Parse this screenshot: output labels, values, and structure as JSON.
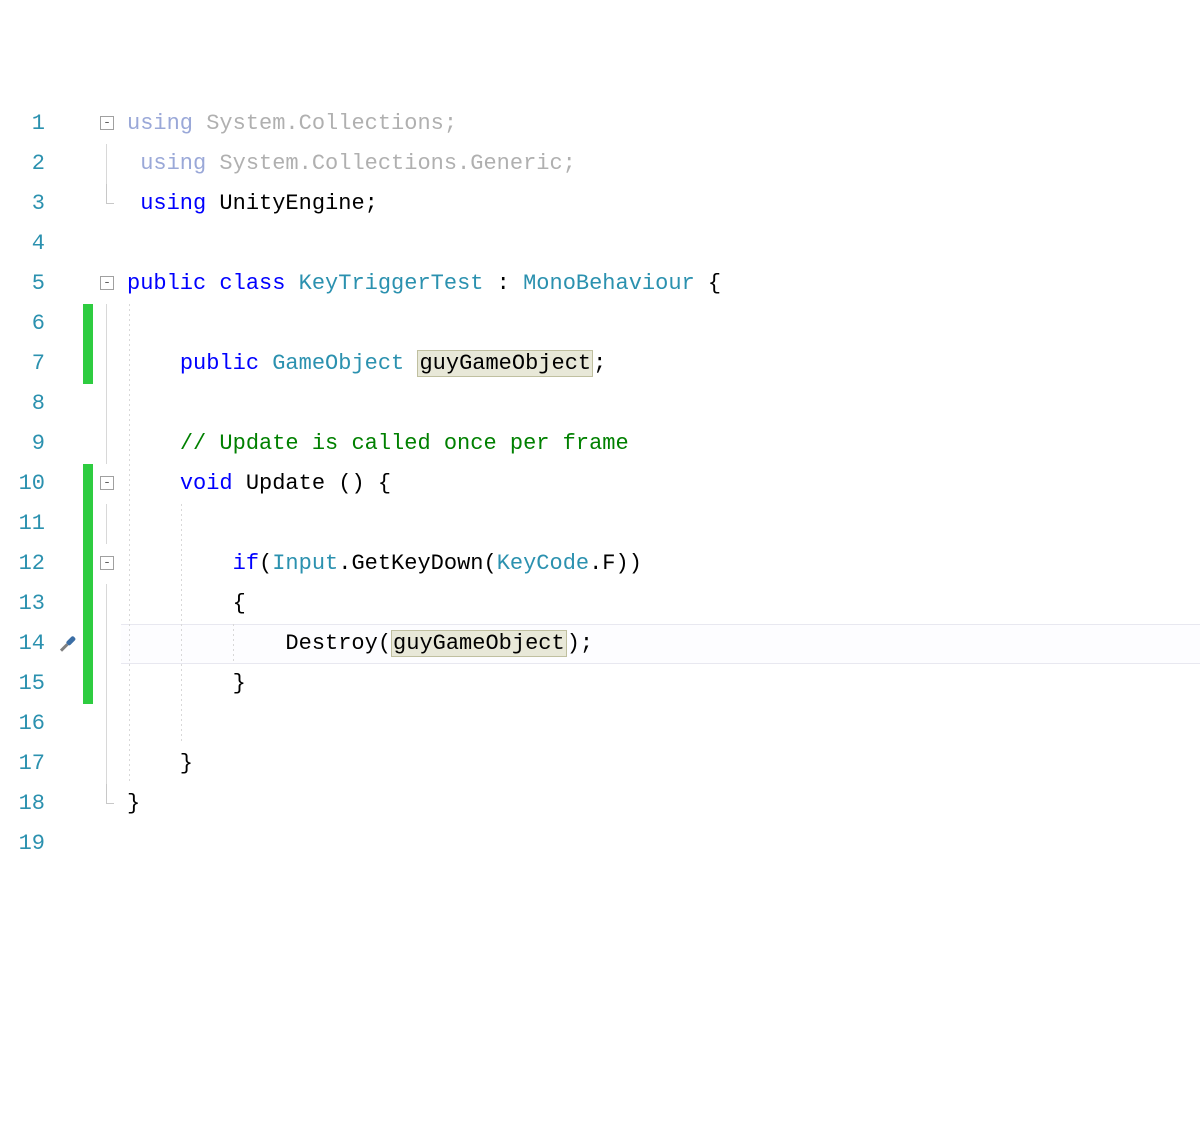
{
  "code": {
    "lines": [
      {
        "n": "1",
        "tokens": [
          {
            "t": "using",
            "c": "kw"
          },
          {
            "t": " System.Collections;",
            "c": ""
          }
        ],
        "dim": true,
        "fold": "minus",
        "change": false,
        "guideStart": true
      },
      {
        "n": "2",
        "tokens": [
          {
            "t": " ",
            "c": ""
          },
          {
            "t": "using",
            "c": "kw"
          },
          {
            "t": " System.Collections.Generic;",
            "c": ""
          }
        ],
        "dim": true,
        "fold": "line",
        "change": false
      },
      {
        "n": "3",
        "tokens": [
          {
            "t": " ",
            "c": ""
          },
          {
            "t": "using",
            "c": "kw"
          },
          {
            "t": " UnityEngine;",
            "c": ""
          }
        ],
        "dim": false,
        "fold": "end",
        "change": false
      },
      {
        "n": "4",
        "tokens": [],
        "dim": false,
        "fold": "",
        "change": false
      },
      {
        "n": "5",
        "tokens": [
          {
            "t": "public",
            "c": "kw"
          },
          {
            "t": " ",
            "c": ""
          },
          {
            "t": "class",
            "c": "kw"
          },
          {
            "t": " ",
            "c": ""
          },
          {
            "t": "KeyTriggerTest",
            "c": "type"
          },
          {
            "t": " : ",
            "c": ""
          },
          {
            "t": "MonoBehaviour",
            "c": "type"
          },
          {
            "t": " {",
            "c": ""
          }
        ],
        "fold": "minus",
        "change": false
      },
      {
        "n": "6",
        "tokens": [],
        "fold": "line",
        "change": true,
        "indent": 1
      },
      {
        "n": "7",
        "tokens": [
          {
            "t": "    ",
            "c": ""
          },
          {
            "t": "public",
            "c": "kw"
          },
          {
            "t": " ",
            "c": ""
          },
          {
            "t": "GameObject",
            "c": "type"
          },
          {
            "t": " ",
            "c": ""
          },
          {
            "t": "guyGameObject",
            "c": "",
            "hl": true
          },
          {
            "t": ";",
            "c": ""
          }
        ],
        "fold": "line",
        "change": true,
        "indent": 1
      },
      {
        "n": "8",
        "tokens": [],
        "fold": "line",
        "change": false,
        "indent": 1
      },
      {
        "n": "9",
        "tokens": [
          {
            "t": "    ",
            "c": ""
          },
          {
            "t": "// Update is called once per frame",
            "c": "cm"
          }
        ],
        "fold": "line",
        "change": false,
        "indent": 1
      },
      {
        "n": "10",
        "tokens": [
          {
            "t": "    ",
            "c": ""
          },
          {
            "t": "void",
            "c": "kw"
          },
          {
            "t": " Update () {",
            "c": ""
          }
        ],
        "fold": "minus",
        "change": true,
        "indent": 1
      },
      {
        "n": "11",
        "tokens": [],
        "fold": "line",
        "change": true,
        "indent": 2
      },
      {
        "n": "12",
        "tokens": [
          {
            "t": "        ",
            "c": ""
          },
          {
            "t": "if",
            "c": "kw"
          },
          {
            "t": "(",
            "c": ""
          },
          {
            "t": "Input",
            "c": "type"
          },
          {
            "t": ".GetKeyDown(",
            "c": ""
          },
          {
            "t": "KeyCode",
            "c": "type"
          },
          {
            "t": ".F))",
            "c": ""
          }
        ],
        "fold": "minus",
        "change": true,
        "indent": 2
      },
      {
        "n": "13",
        "tokens": [
          {
            "t": "        {",
            "c": ""
          }
        ],
        "fold": "line",
        "change": true,
        "indent": 2
      },
      {
        "n": "14",
        "tokens": [
          {
            "t": "            Destroy(",
            "c": ""
          },
          {
            "t": "guyGameObject",
            "c": "",
            "hl": true
          },
          {
            "t": ");",
            "c": ""
          }
        ],
        "fold": "line",
        "change": true,
        "current": true,
        "icon": "screwdriver",
        "indent": 3
      },
      {
        "n": "15",
        "tokens": [
          {
            "t": "        }",
            "c": ""
          }
        ],
        "fold": "line",
        "change": true,
        "indent": 2
      },
      {
        "n": "16",
        "tokens": [],
        "fold": "line",
        "change": false,
        "indent": 2
      },
      {
        "n": "17",
        "tokens": [
          {
            "t": "    }",
            "c": ""
          }
        ],
        "fold": "line",
        "change": false,
        "indent": 1
      },
      {
        "n": "18",
        "tokens": [
          {
            "t": "}",
            "c": ""
          }
        ],
        "fold": "end",
        "change": false
      },
      {
        "n": "19",
        "tokens": [],
        "fold": "",
        "change": false
      }
    ]
  },
  "fold_symbols": {
    "minus": "−",
    "line": "│",
    "end": "└"
  }
}
